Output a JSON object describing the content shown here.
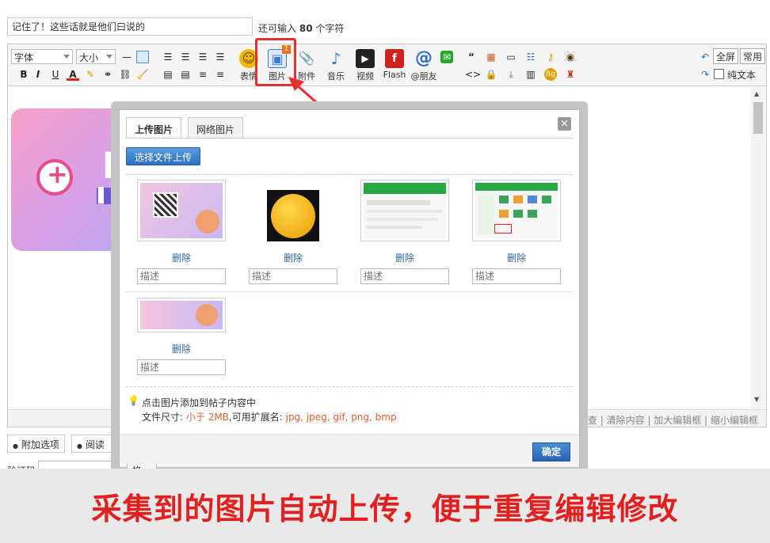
{
  "title_input": {
    "value": "记住了！这些话就是他们曰说的"
  },
  "remaining": {
    "prefix": "还可输入",
    "count": "80",
    "suffix": "个字符"
  },
  "toolbar": {
    "font_select": "字体",
    "size_select": "大小",
    "format_buttons": [
      "B",
      "I",
      "U",
      "A"
    ],
    "big_buttons": [
      {
        "label": "表情",
        "icon": "smiley-icon",
        "color": "#f0b800"
      },
      {
        "label": "图片",
        "icon": "image-icon",
        "color": "#3a7bd5"
      },
      {
        "label": "附件",
        "icon": "paperclip-icon",
        "color": "#4a6fb0"
      },
      {
        "label": "音乐",
        "icon": "music-note-icon",
        "color": "#2a7fd0"
      },
      {
        "label": "视频",
        "icon": "film-icon",
        "color": "#222222"
      },
      {
        "label": "Flash",
        "icon": "flash-icon",
        "color": "#d02020"
      },
      {
        "label": "@朋友",
        "icon": "at-icon",
        "color": "#2a6fc4"
      }
    ],
    "image_badge": "1",
    "fullscreen": "全屏",
    "common": "常用",
    "plain_text": "纯文本"
  },
  "status_bar": {
    "items": [
      "查",
      "清除内容",
      "加大编辑框",
      "缩小编辑框"
    ]
  },
  "below_editor": {
    "extra_options": "附加选项",
    "read_perm": "阅读权",
    "captcha_label": "验证码",
    "refresh": "换一"
  },
  "dialog": {
    "tabs": [
      "上传图片",
      "网络图片"
    ],
    "close": "×",
    "upload_button": "选择文件上传",
    "images": [
      {
        "delete": "删除",
        "desc_placeholder": "描述",
        "kind": "qr-banner"
      },
      {
        "delete": "删除",
        "desc_placeholder": "描述",
        "kind": "emoji"
      },
      {
        "delete": "删除",
        "desc_placeholder": "描述",
        "kind": "green-site"
      },
      {
        "delete": "删除",
        "desc_placeholder": "描述",
        "kind": "green-dashboard"
      },
      {
        "delete": "删除",
        "desc_placeholder": "描述",
        "kind": "pink-banner"
      }
    ],
    "tip": "点击图片添加到帖子内容中",
    "file_size_prefix": "文件尺寸:",
    "file_size_value": "小于 2MB",
    "ext_prefix": ",可用扩展名:",
    "ext_value": "jpg, jpeg, gif, png, bmp",
    "confirm": "确定"
  },
  "caption": "采集到的图片自动上传，便于重复编辑修改",
  "colors": {
    "accent_red": "#e32020",
    "button_blue": "#2d6fc4"
  }
}
